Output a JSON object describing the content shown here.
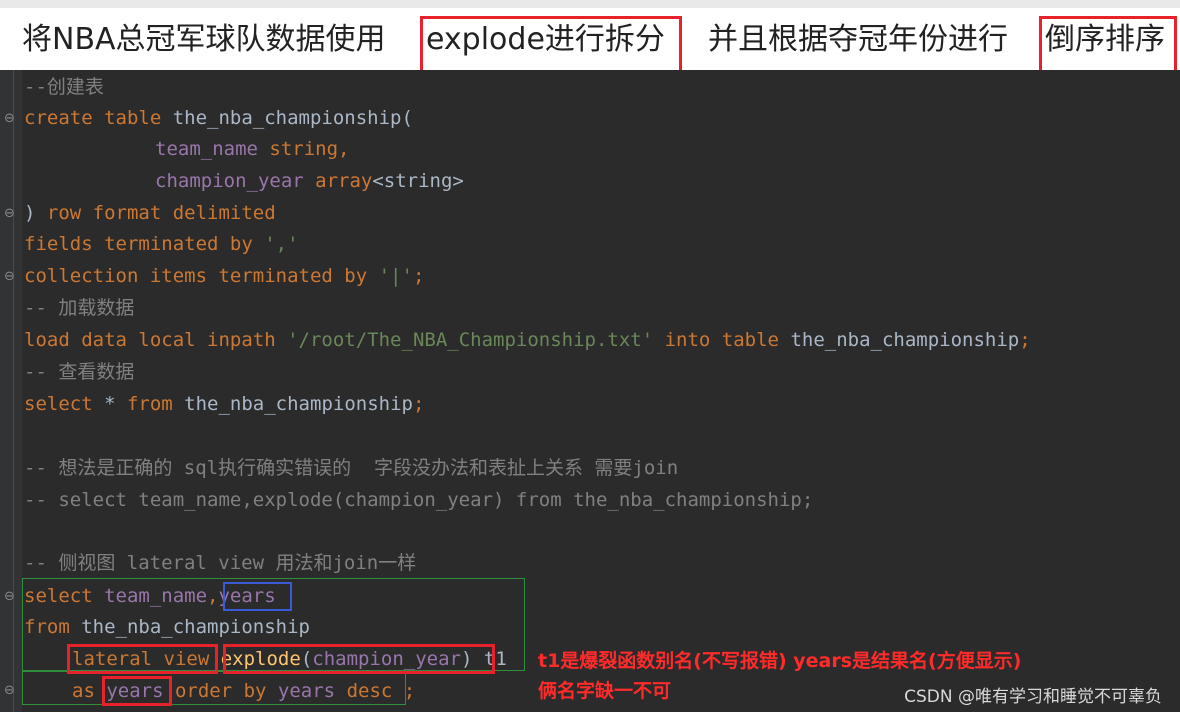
{
  "title": {
    "part1": "将NBA总冠军球队数据使用",
    "highlight1": "explode进行拆分",
    "part2": "并且根据夺冠年份进行",
    "highlight2": "倒序排序"
  },
  "code": {
    "l1": "--创建表",
    "l2a": "create table",
    "l2b": " the_nba_championship(",
    "l3a": "team_name",
    "l3b": " string,",
    "l4a": "champion_year",
    "l4b": " array",
    "l4c": "<string>",
    "l5a": ") ",
    "l5b": "row format delimited",
    "l6a": "fields terminated by ",
    "l6b": "','",
    "l7a": "collection items terminated by ",
    "l7b": "'|'",
    "l7c": ";",
    "l8": "-- 加载数据",
    "l9a": "load data local inpath ",
    "l9b": "'/root/The_NBA_Championship.txt'",
    "l9c": " into table ",
    "l9d": "the_nba_championship",
    "l9e": ";",
    "l10": "-- 查看数据",
    "l11a": "select ",
    "l11b": "* ",
    "l11c": "from ",
    "l11d": "the_nba_championship",
    "l11e": ";",
    "l13": "-- 想法是正确的 sql执行确实错误的  字段没办法和表扯上关系 需要join",
    "l14": "-- select team_name,explode(champion_year) from the_nba_championship;",
    "l16": "-- 侧视图 lateral view 用法和join一样",
    "l17a": "select ",
    "l17b": "team_name",
    "l17c": ",",
    "l17d": "years",
    "l18a": "from ",
    "l18b": "the_nba_championship",
    "l19a": "lateral view",
    "l19b": "explode",
    "l19c": "(",
    "l19d": "champion_year",
    "l19e": ")",
    "l19f": " t1",
    "l20a": "as ",
    "l20b": "years",
    "l20c": " order by ",
    "l20d": "years",
    "l20e": " desc",
    "l20f": " ;"
  },
  "annotations": {
    "a1": "t1是爆裂函数别名(不写报错)  years是结果名(方便显示)",
    "a2": "俩名字缺一不可"
  },
  "watermark": "CSDN @唯有学习和睡觉不可辜负",
  "colors": {
    "keyword": "#cc7832",
    "comment": "#808080",
    "string": "#6a8759",
    "field": "#9876aa",
    "function": "#ffc66d",
    "highlight_box": "#e8222a",
    "annotation": "#ff2a2a"
  },
  "icons": [
    "fold-icon"
  ]
}
